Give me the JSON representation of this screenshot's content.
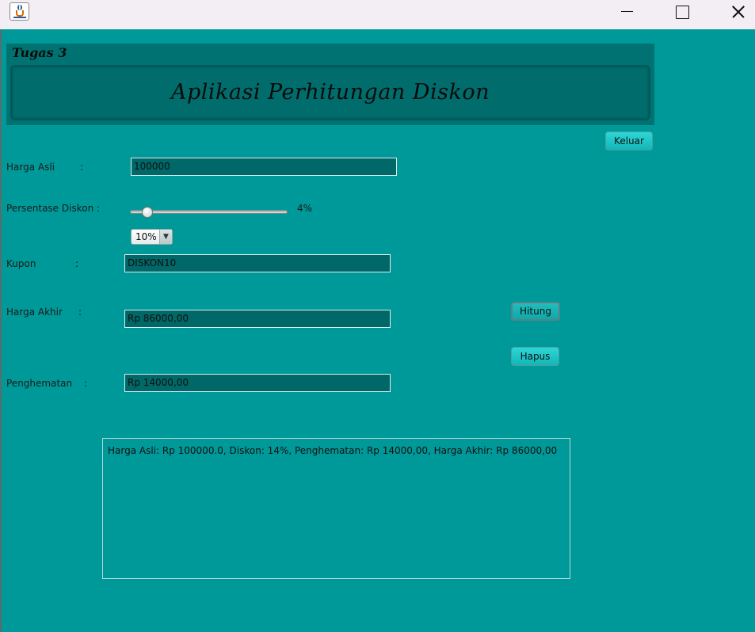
{
  "window": {
    "icon": "java-cup-icon"
  },
  "header": {
    "course": "Tugas 3",
    "title": "Aplikasi Perhitungan Diskon"
  },
  "buttons": {
    "exit": "Keluar",
    "calculate": "Hitung",
    "clear": "Hapus"
  },
  "form": {
    "original_price_label": "Harga Asli",
    "discount_percent_label": "Persentase Diskon :",
    "coupon_label": "Kupon",
    "final_price_label": "Harga Akhir",
    "savings_label": "Penghematan",
    "colon": ":",
    "original_price_value": "100000",
    "slider_value_text": "4%",
    "slider_level_percent": 4,
    "discount_select": "10%",
    "coupon_value": "DISKON10",
    "final_price_value": "Rp 86000,00",
    "savings_value": "Rp 14000,00"
  },
  "output": {
    "text": "Harga Asli: Rp 100000.0, Diskon: 14%, Penghematan: Rp 14000,00, Harga Akhir: Rp 86000,00"
  },
  "colors": {
    "background": "#009999",
    "header_panel": "#007272",
    "field": "#006868",
    "button": "#20c6c6"
  }
}
